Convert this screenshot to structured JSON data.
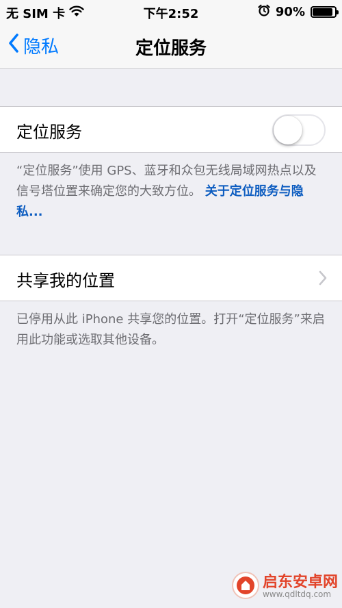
{
  "status_bar": {
    "carrier": "无 SIM 卡",
    "time": "下午2:52",
    "battery_percent": "90%",
    "battery_level": 0.9,
    "icons": [
      "wifi-icon",
      "alarm-icon",
      "battery-icon"
    ]
  },
  "nav": {
    "back_label": "隐私",
    "title": "定位服务"
  },
  "location_services": {
    "label": "定位服务",
    "toggle_on": false,
    "description": "“定位服务”使用 GPS、蓝牙和众包无线局域网热点以及信号塔位置来确定您的大致方位。",
    "link_text": "关于定位服务与隐私..."
  },
  "share_location": {
    "label": "共享我的位置",
    "description": "已停用从此 iPhone 共享您的位置。打开“定位服务”来启用此功能或选取其他设备。"
  },
  "watermark": {
    "name": "启东安卓网",
    "url": "www.qdltdq.com"
  },
  "colors": {
    "accent": "#007aff",
    "link": "#0c5cc0",
    "background": "#efeff4",
    "watermark": "#e2442a"
  }
}
